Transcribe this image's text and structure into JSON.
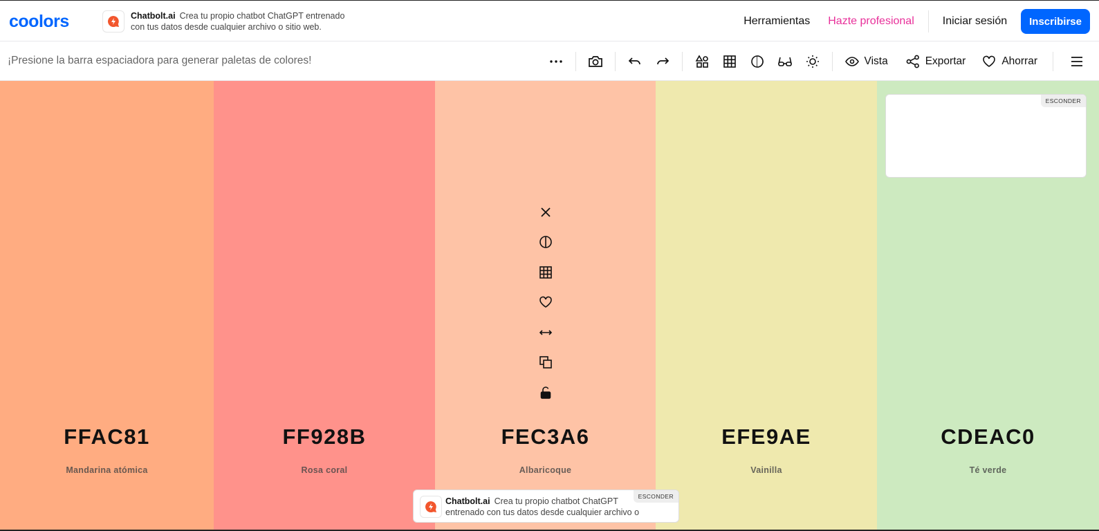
{
  "header": {
    "logo_text": "coolors",
    "ad": {
      "brand": "Chatbolt.ai",
      "text": "Crea tu propio chatbot ChatGPT entrenado con tus datos desde cualquier archivo o sitio web."
    },
    "nav": {
      "tools": "Herramientas",
      "pro": "Hazte profesional",
      "login": "Iniciar sesión",
      "signup": "Inscribirse"
    }
  },
  "toolbar": {
    "hint": "¡Presione la barra espaciadora para generar paletas de colores!",
    "view_label": "Vista",
    "export_label": "Exportar",
    "save_label": "Ahorrar",
    "icons": [
      "more-icon",
      "camera-icon",
      "undo-icon",
      "redo-icon",
      "shapes-icon",
      "grid-icon",
      "contrast-icon",
      "glasses-icon",
      "sun-icon",
      "eye-icon",
      "share-icon",
      "heart-icon",
      "hamburger-icon"
    ]
  },
  "palette": {
    "colors": [
      {
        "hex": "FFAC81",
        "name": "Mandarina atómica",
        "color": "#FFAC81"
      },
      {
        "hex": "FF928B",
        "name": "Rosa coral",
        "color": "#FF928B"
      },
      {
        "hex": "FEC3A6",
        "name": "Albaricoque",
        "color": "#FEC3A6"
      },
      {
        "hex": "EFE9AE",
        "name": "Vainilla",
        "color": "#EFE9AE"
      },
      {
        "hex": "CDEAC0",
        "name": "Té verde",
        "color": "#CDEAC0"
      }
    ],
    "swatch_tool_icons": [
      "close-icon",
      "contrast-icon",
      "grid-icon",
      "heart-icon",
      "drag-arrows-icon",
      "copy-icon",
      "lock-icon"
    ]
  },
  "side_card": {
    "hide_label": "ESCONDER"
  },
  "bottom_ad": {
    "brand": "Chatbolt.ai",
    "text": "Crea tu propio chatbot ChatGPT entrenado con tus datos desde cualquier archivo o",
    "hide_label": "ESCONDER"
  },
  "colors": {
    "accent": "#0066ff",
    "pro": "#e8309a"
  }
}
